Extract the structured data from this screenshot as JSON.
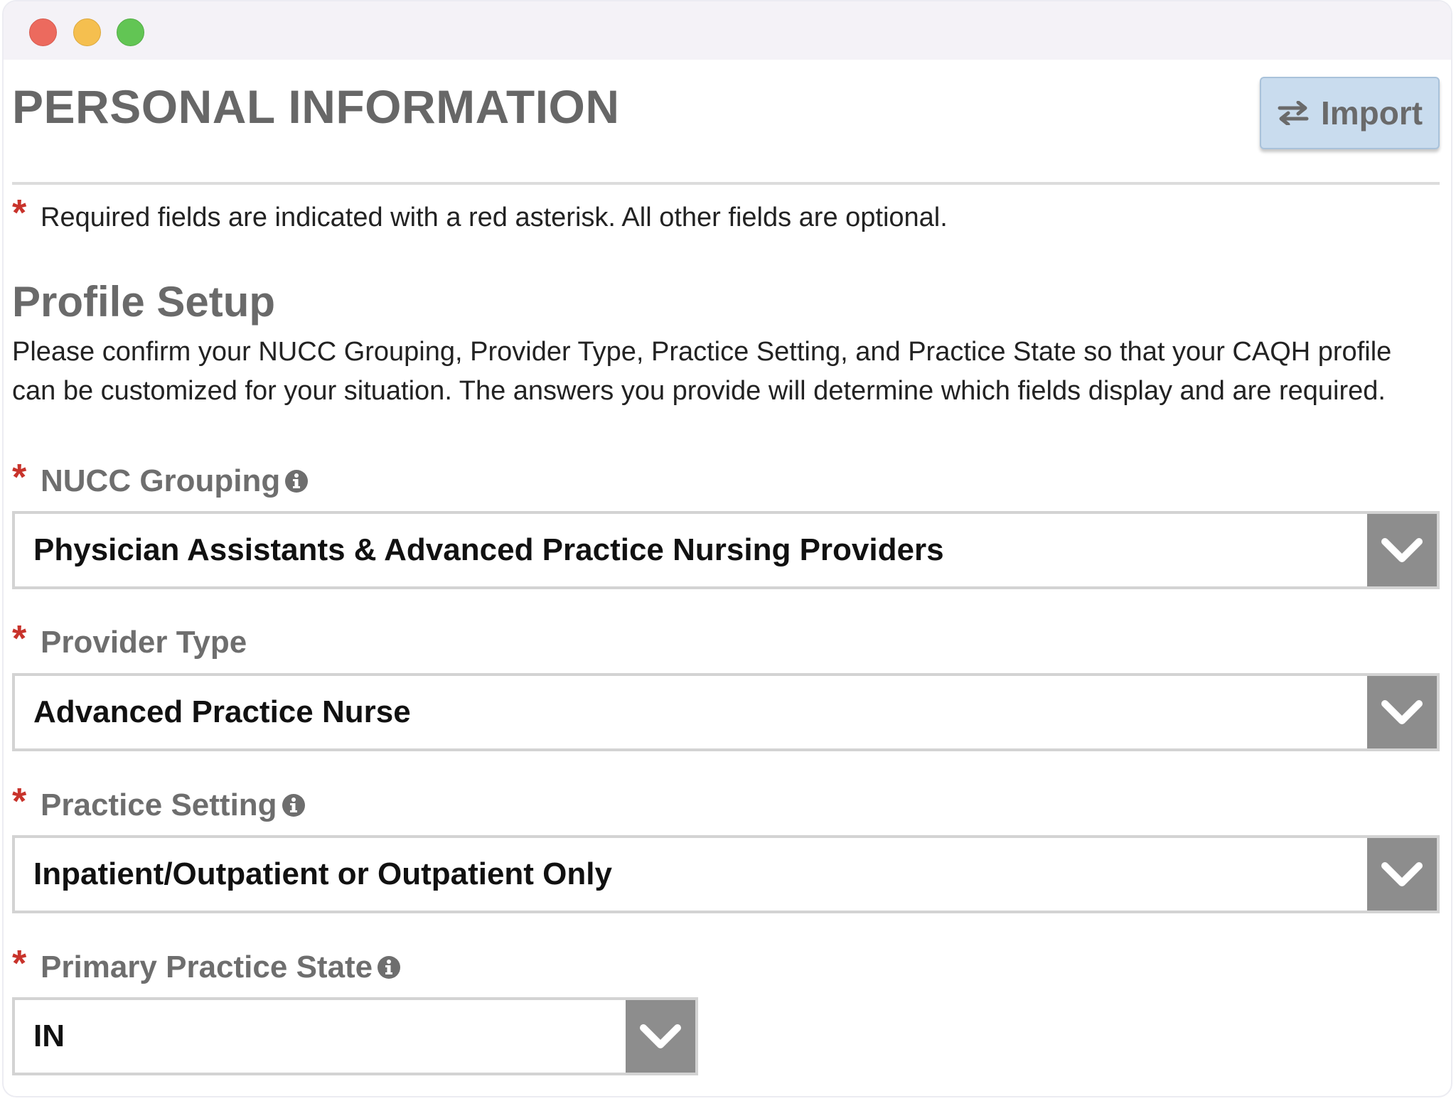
{
  "header": {
    "title": "PERSONAL INFORMATION",
    "import_label": "Import"
  },
  "required_note": {
    "asterisk": "*",
    "text": "Required fields are indicated with a red asterisk. All other fields are optional."
  },
  "profile_setup": {
    "title": "Profile Setup",
    "description": "Please confirm your NUCC Grouping, Provider Type, Practice Setting, and Practice State so that your CAQH profile can be customized for your situation. The answers you provide will determine which fields display and are required."
  },
  "fields": {
    "nucc_grouping": {
      "asterisk": "*",
      "label": "NUCC Grouping",
      "value": "Physician Assistants & Advanced Practice Nursing Providers",
      "has_info": true
    },
    "provider_type": {
      "asterisk": "*",
      "label": "Provider Type",
      "value": "Advanced Practice Nurse",
      "has_info": false
    },
    "practice_setting": {
      "asterisk": "*",
      "label": "Practice Setting",
      "value": "Inpatient/Outpatient or Outpatient Only",
      "has_info": true
    },
    "primary_practice_state": {
      "asterisk": "*",
      "label": "Primary Practice State",
      "value": "IN",
      "has_info": true
    }
  },
  "colors": {
    "required_asterisk": "#c8332b",
    "import_button_bg": "#c9dcee",
    "dropdown_arrow_bg": "#8d8d8d",
    "heading_gray": "#676767"
  },
  "icons": {
    "import": "swap-arrows-icon",
    "info": "info-circle-icon",
    "dropdown": "chevron-down-icon"
  }
}
